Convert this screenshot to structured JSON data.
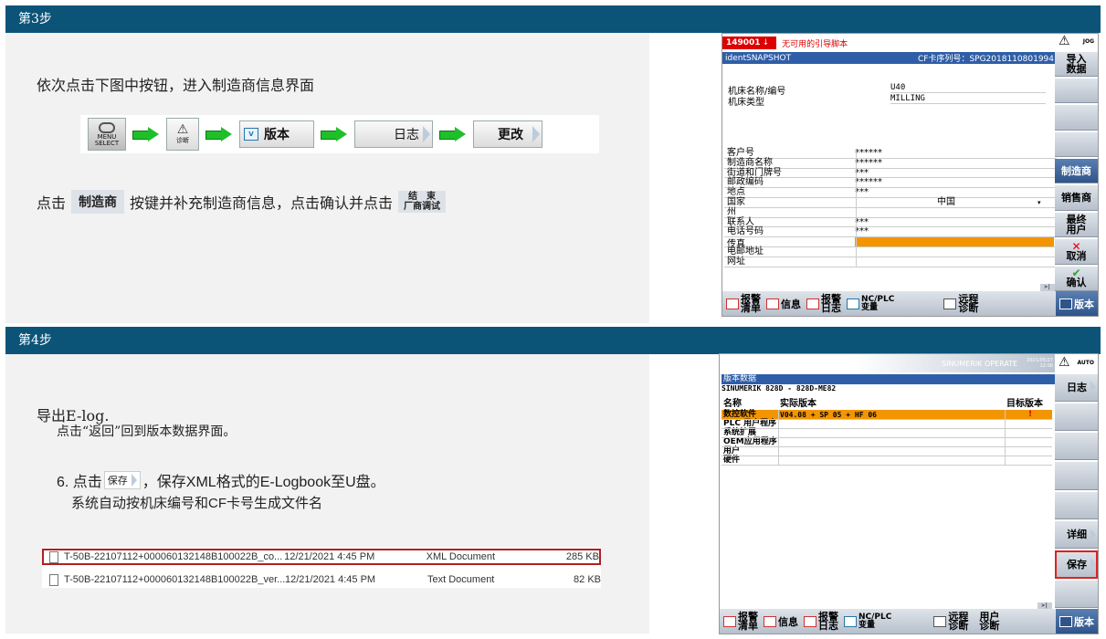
{
  "step3": {
    "header": "第3步",
    "instruction": "依次点击下图中按钮，进入制造商信息界面",
    "flow": {
      "menu_select_label": "MENU\nSELECT",
      "diag_label": "诊断",
      "version_label": "版本",
      "log_label": "日志",
      "change_label": "更改"
    },
    "line2_a": "点击",
    "line2_btn": "制造商",
    "line2_b": "按键并补充制造商信息，点击确认并点击",
    "finish_btn_top": "结　束",
    "finish_btn_bottom": "厂商调试",
    "hmi": {
      "alarm_no": "149001",
      "alarm_text": "无可用的引导脚本",
      "title": "identSNAPSHOT",
      "cf_label": "CF卡序列号：",
      "cf_value": "SPG2018110801994",
      "machine_name_label": "机床名称/编号",
      "machine_name_value": "U40",
      "machine_type_label": "机床类型",
      "machine_type_value": "MILLING",
      "fields": [
        {
          "label": "客户号",
          "value": "******"
        },
        {
          "label": "制造商名称",
          "value": "******"
        },
        {
          "label": "街道和门牌号",
          "value": "***"
        },
        {
          "label": "邮政编码",
          "value": "******"
        },
        {
          "label": "地点",
          "value": "***"
        },
        {
          "label": "国家",
          "value": "中国"
        },
        {
          "label": "州",
          "value": ""
        },
        {
          "label": "联系人",
          "value": "***"
        },
        {
          "label": "电话号码",
          "value": "***"
        },
        {
          "label": "传真",
          "value": ""
        },
        {
          "label": "电邮地址",
          "value": ""
        },
        {
          "label": "网址",
          "value": ""
        }
      ],
      "softkeys": [
        "导入\n数据",
        "",
        "",
        "",
        "制造商",
        "销售商",
        "最终\n用户",
        "取消",
        "确认"
      ],
      "jog": "JOG",
      "bottom": [
        "报警\n清单",
        "信息",
        "报警\n日志",
        "NC/PLC\n变量",
        "远程\n诊断"
      ],
      "version_btn": "版本"
    }
  },
  "step4": {
    "header": "第4步",
    "line1": "导出E-log.",
    "line2": "点击“返回”回到版本数据界面。",
    "line3_a": "6. 点击",
    "save_btn": "保存",
    "line3_b": "，保存XML格式的E-Logbook至U盘。",
    "line4": "系统自动按机床编号和CF卡号生成文件名",
    "files": [
      {
        "name": "T-50B-22107112+000060132148B100022B_co...",
        "date": "12/21/2021 4:45 PM",
        "type": "XML Document",
        "size": "285 KB"
      },
      {
        "name": "T-50B-22107112+000060132148B100022B_ver...",
        "date": "12/21/2021 4:45 PM",
        "type": "Text Document",
        "size": "82 KB"
      }
    ],
    "hmi": {
      "brand": "SINUMERIK OPERATE",
      "date": "2021/05/27",
      "time": "12:00",
      "auto": "AUTO",
      "title": "版本数据",
      "subtitle": "SINUMERIK 828D - 828D-ME82",
      "col_name": "名称",
      "col_actual": "实际版本",
      "col_target": "目标版本",
      "rows": [
        {
          "name": "数控软件",
          "actual": "V04.08 + SP 05 + HF 06",
          "target": "!"
        },
        {
          "name": "PLC 用户程序",
          "actual": "",
          "target": ""
        },
        {
          "name": "系统扩展",
          "actual": "",
          "target": ""
        },
        {
          "name": "OEM应用程序",
          "actual": "",
          "target": ""
        },
        {
          "name": "用户",
          "actual": "",
          "target": ""
        },
        {
          "name": "硬件",
          "actual": "",
          "target": ""
        }
      ],
      "softkeys": [
        "日志",
        "",
        "",
        "",
        "",
        "详细",
        "保存",
        ""
      ],
      "bottom": [
        "报警\n清单",
        "信息",
        "报警\n日志",
        "NC/PLC\n变量",
        "远程\n诊断",
        "用户\n诊断"
      ],
      "version_btn": "版本"
    }
  }
}
